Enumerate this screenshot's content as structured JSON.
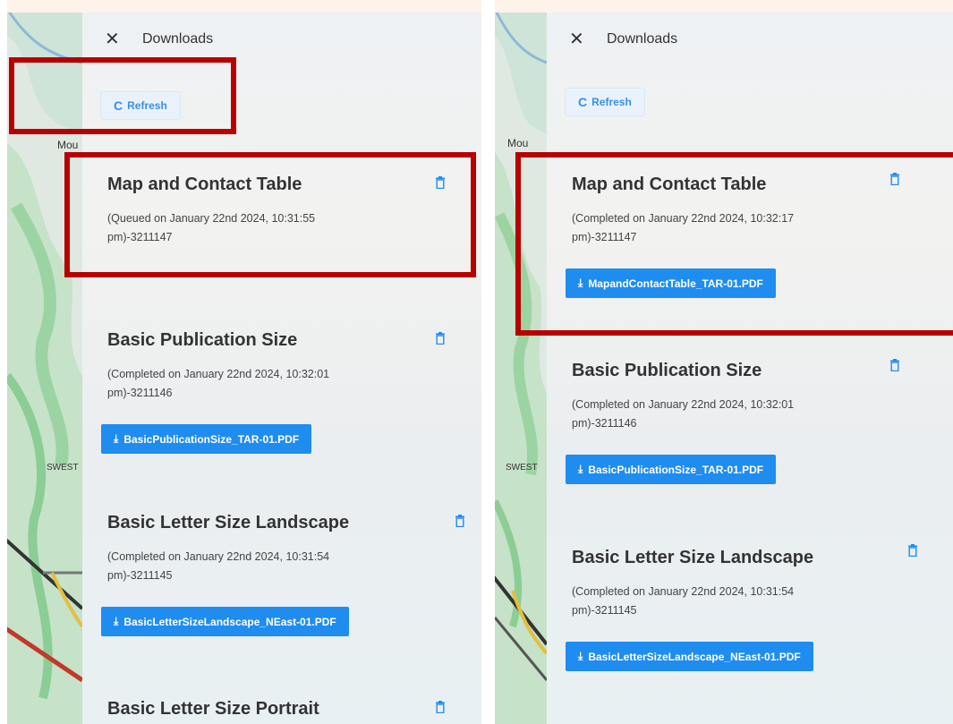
{
  "panel": {
    "title": "Downloads",
    "refresh_label": "Refresh"
  },
  "map_labels": {
    "mountain": "Mou",
    "area": "SWEST"
  },
  "left": {
    "items": [
      {
        "title": "Map and Contact Table",
        "status": "(Queued on January 22nd 2024, 10:31:55 pm)-3211147"
      },
      {
        "title": "Basic Publication Size",
        "status": "(Completed on January 22nd 2024, 10:32:01 pm)-3211146",
        "file": "BasicPublicationSize_TAR-01.PDF"
      },
      {
        "title": "Basic Letter Size Landscape",
        "status": "(Completed on January 22nd 2024, 10:31:54 pm)-3211145",
        "file": "BasicLetterSizeLandscape_NEast-01.PDF"
      },
      {
        "title": "Basic Letter Size Portrait"
      }
    ]
  },
  "right": {
    "items": [
      {
        "title": "Map and Contact Table",
        "status": "(Completed on January 22nd 2024, 10:32:17 pm)-3211147",
        "file": "MapandContactTable_TAR-01.PDF"
      },
      {
        "title": "Basic Publication Size",
        "status": "(Completed on January 22nd 2024, 10:32:01 pm)-3211146",
        "file": "BasicPublicationSize_TAR-01.PDF"
      },
      {
        "title": "Basic Letter Size Landscape",
        "status": "(Completed on January 22nd 2024, 10:31:54 pm)-3211145",
        "file": "BasicLetterSizeLandscape_NEast-01.PDF"
      }
    ]
  },
  "colors": {
    "accent": "#1f8cf0",
    "highlight": "#b70000",
    "refresh_text": "#3a8fe4"
  },
  "icons": {
    "close": "close-icon",
    "refresh": "refresh-icon",
    "download": "download-icon",
    "trash": "trash-icon"
  }
}
